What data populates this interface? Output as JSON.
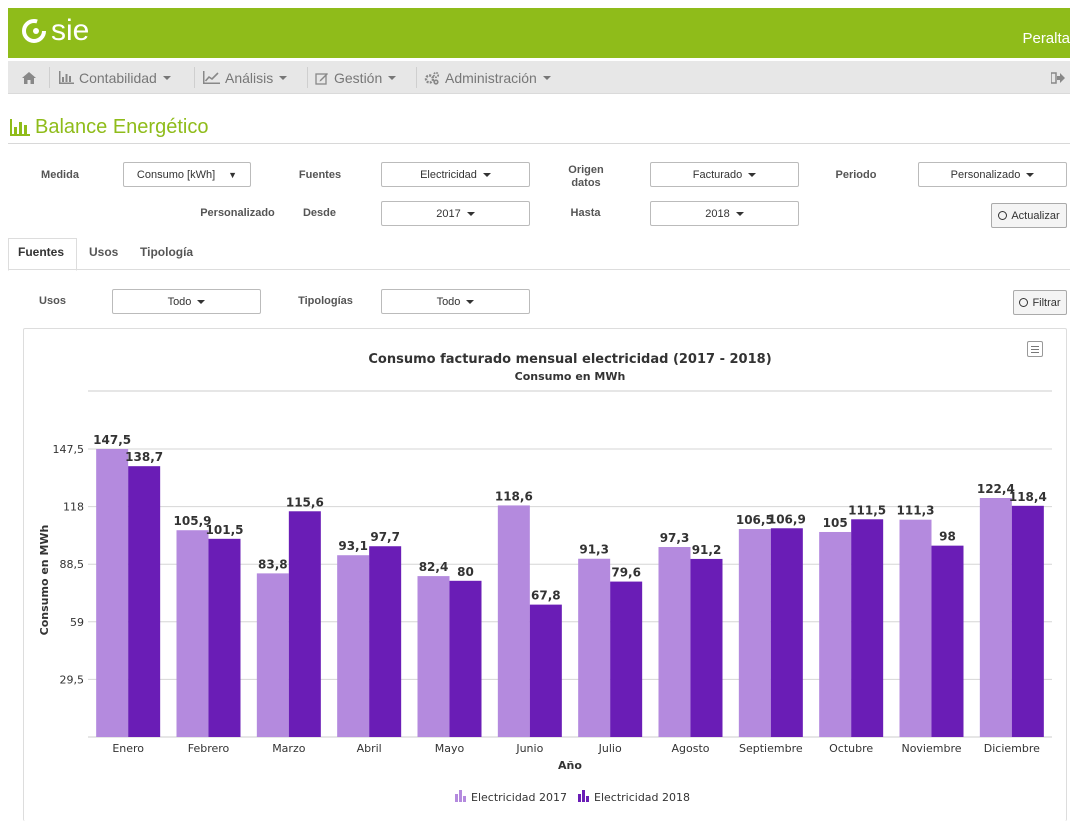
{
  "app": {
    "logo_text": "sie",
    "user_name": "Peralta"
  },
  "nav": {
    "items": [
      {
        "label": "Contabilidad"
      },
      {
        "label": "Análisis"
      },
      {
        "label": "Gestión"
      },
      {
        "label": "Administración"
      }
    ]
  },
  "page": {
    "title": "Balance Energético"
  },
  "form": {
    "medida_label": "Medida",
    "medida_value": "Consumo [kWh]",
    "fuentes_label": "Fuentes",
    "fuentes_value": "Electricidad",
    "origen_label_1": "Origen",
    "origen_label_2": "datos",
    "origen_value": "Facturado",
    "periodo_label": "Periodo",
    "periodo_value": "Personalizado",
    "personalizado_label": "Personalizado",
    "desde_label": "Desde",
    "desde_value": "2017",
    "hasta_label": "Hasta",
    "hasta_value": "2018",
    "actualizar_label": "Actualizar"
  },
  "tabs": [
    {
      "label": "Fuentes",
      "active": true
    },
    {
      "label": "Usos",
      "active": false
    },
    {
      "label": "Tipología",
      "active": false
    }
  ],
  "filters": {
    "usos_label": "Usos",
    "usos_value": "Todo",
    "tipologias_label": "Tipologías",
    "tipologias_value": "Todo",
    "filtrar_label": "Filtrar"
  },
  "colors": {
    "brand": "#8fbc1a",
    "series_2017": "#b48ade",
    "series_2018": "#6a1db6"
  },
  "chart_data": {
    "type": "bar",
    "title": "Consumo facturado mensual electricidad (2017 - 2018)",
    "subtitle": "Consumo en MWh",
    "xlabel": "Año",
    "ylabel": "Consumo en MWh",
    "ylim": [
      0,
      147.5
    ],
    "yticks": [
      "29,5",
      "59",
      "88,5",
      "118",
      "147,5"
    ],
    "ytick_values": [
      29.5,
      59,
      88.5,
      118,
      147.5
    ],
    "grid": true,
    "legend_position": "bottom-center",
    "categories": [
      "Enero",
      "Febrero",
      "Marzo",
      "Abril",
      "Mayo",
      "Junio",
      "Julio",
      "Agosto",
      "Septiembre",
      "Octubre",
      "Noviembre",
      "Diciembre"
    ],
    "series": [
      {
        "name": "Electricidad 2017",
        "color": "#b48ade",
        "values": [
          147.5,
          105.9,
          83.8,
          93.1,
          82.4,
          118.6,
          91.3,
          97.3,
          106.5,
          105,
          111.3,
          122.4
        ],
        "labels": [
          "147,5",
          "105,9",
          "83,8",
          "93,1",
          "82,4",
          "118,6",
          "91,3",
          "97,3",
          "106,5",
          "105",
          "111,3",
          "122,4"
        ]
      },
      {
        "name": "Electricidad 2018",
        "color": "#6a1db6",
        "values": [
          138.7,
          101.5,
          115.6,
          97.7,
          80,
          67.8,
          79.6,
          91.2,
          106.9,
          111.5,
          98,
          118.4
        ],
        "labels": [
          "138,7",
          "101,5",
          "115,6",
          "97,7",
          "80",
          "67,8",
          "79,6",
          "91,2",
          "106,9",
          "111,5",
          "98",
          "118,4"
        ]
      }
    ]
  }
}
